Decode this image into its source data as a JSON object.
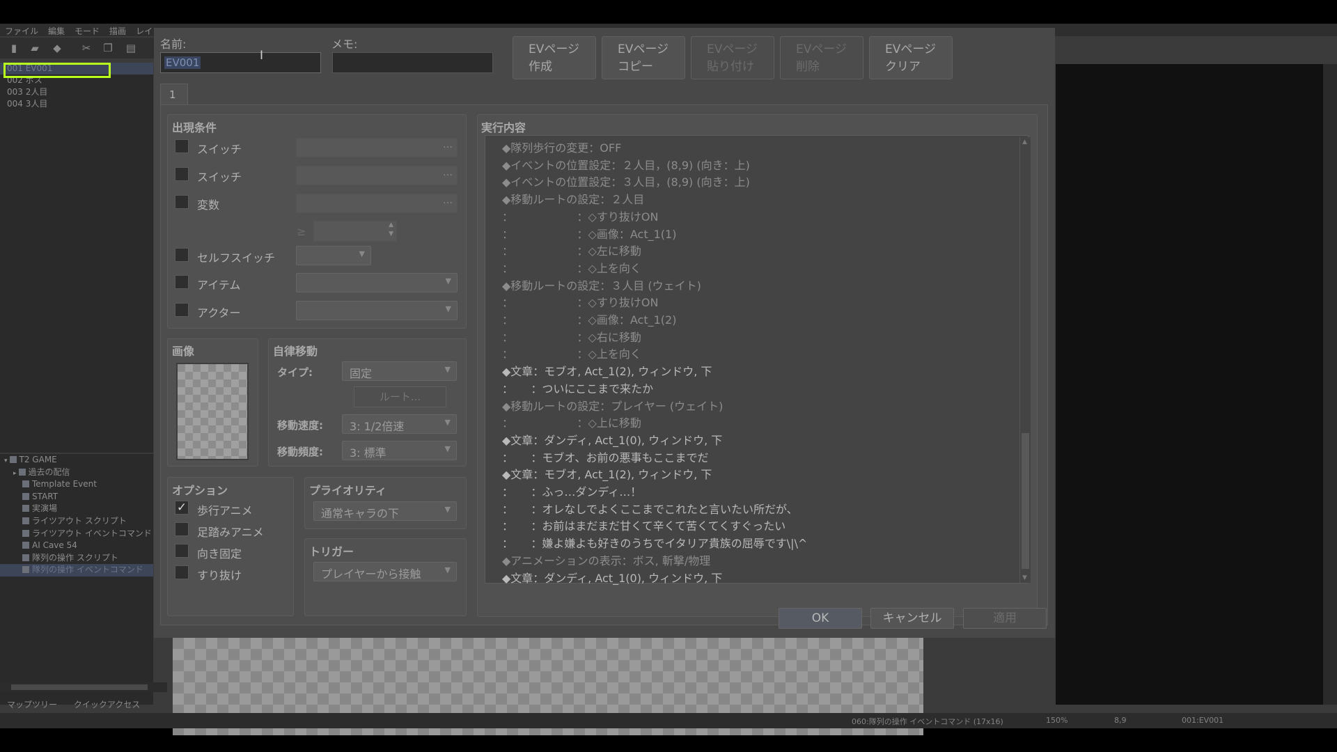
{
  "menubar": [
    "ファイル",
    "編集",
    "モード",
    "描画",
    "レイ"
  ],
  "event_list": [
    {
      "label": "001 EV001",
      "selected": true
    },
    {
      "label": "002 ボス",
      "selected": false
    },
    {
      "label": "003 2人目",
      "selected": false
    },
    {
      "label": "004 3人目",
      "selected": false
    }
  ],
  "map_tree": [
    {
      "label": "T2 GAME",
      "indent": 0,
      "expander": "▾",
      "selected": false
    },
    {
      "label": "過去の配信",
      "indent": 1,
      "expander": "▸",
      "selected": false
    },
    {
      "label": "Template Event",
      "indent": 2,
      "expander": "",
      "selected": false
    },
    {
      "label": "START",
      "indent": 2,
      "expander": "",
      "selected": false
    },
    {
      "label": "実演場",
      "indent": 2,
      "expander": "",
      "selected": false
    },
    {
      "label": "ライツアウト スクリプト",
      "indent": 2,
      "expander": "",
      "selected": false
    },
    {
      "label": "ライツアウト イベントコマンド",
      "indent": 2,
      "expander": "",
      "selected": false
    },
    {
      "label": "AI Cave 54",
      "indent": 2,
      "expander": "",
      "selected": false
    },
    {
      "label": "隊列の操作 スクリプト",
      "indent": 2,
      "expander": "",
      "selected": false
    },
    {
      "label": "隊列の操作 イベントコマンド",
      "indent": 2,
      "expander": "",
      "selected": true
    }
  ],
  "tree_tabs": [
    "マップツリー",
    "クイックアクセス"
  ],
  "status": {
    "map": "060:隊列の操作 イベントコマンド (17x16)",
    "zoom": "150%",
    "coords": "8,9",
    "event": "001:EV001"
  },
  "dialog": {
    "name_label": "名前:",
    "name_value": "EV001",
    "memo_label": "メモ:",
    "memo_value": "",
    "page_buttons": [
      {
        "label": "EVページ\n作成",
        "enabled": true
      },
      {
        "label": "EVページ\nコピー",
        "enabled": true
      },
      {
        "label": "EVページ\n貼り付け",
        "enabled": false
      },
      {
        "label": "EVページ\n削除",
        "enabled": false
      },
      {
        "label": "EVページ\nクリア",
        "enabled": true
      }
    ],
    "page_tab": "1",
    "conditions": {
      "title": "出現条件",
      "switch1": "スイッチ",
      "switch2": "スイッチ",
      "variable": "変数",
      "variable_value": "",
      "self_switch": "セルフスイッチ",
      "item": "アイテム",
      "actor": "アクター",
      "dots": "…",
      "ge": "≥"
    },
    "image": {
      "title": "画像"
    },
    "autonomous": {
      "title": "自律移動",
      "type_label": "タイプ:",
      "type_value": "固定",
      "route_button": "ルート...",
      "speed_label": "移動速度:",
      "speed_value": "3: 1/2倍速",
      "freq_label": "移動頻度:",
      "freq_value": "3: 標準"
    },
    "options": {
      "title": "オプション",
      "items": [
        {
          "label": "歩行アニメ",
          "checked": true
        },
        {
          "label": "足踏みアニメ",
          "checked": false
        },
        {
          "label": "向き固定",
          "checked": false
        },
        {
          "label": "すり抜け",
          "checked": false
        }
      ]
    },
    "priority": {
      "title": "プライオリティ",
      "value": "通常キャラの下"
    },
    "trigger": {
      "title": "トリガー",
      "value": "プレイヤーから接触"
    },
    "contents": {
      "title": "実行内容",
      "lines": [
        {
          "text": "◆隊列歩行の変更：OFF",
          "dim": true
        },
        {
          "text": "◆イベントの位置設定：２人目，(8,9) (向き：上)",
          "dim": true
        },
        {
          "text": "◆イベントの位置設定：３人目，(8,9) (向き：上)",
          "dim": true
        },
        {
          "text": "◆移動ルートの設定：２人目",
          "dim": true
        },
        {
          "text": "：                  ：◇すり抜けON",
          "dim": true
        },
        {
          "text": "：                  ：◇画像：Act_1(1)",
          "dim": true
        },
        {
          "text": "：                  ：◇左に移動",
          "dim": true
        },
        {
          "text": "：                  ：◇上を向く",
          "dim": true
        },
        {
          "text": "◆移動ルートの設定：３人目 (ウェイト)",
          "dim": true
        },
        {
          "text": "：                  ：◇すり抜けON",
          "dim": true
        },
        {
          "text": "：                  ：◇画像：Act_1(2)",
          "dim": true
        },
        {
          "text": "：                  ：◇右に移動",
          "dim": true
        },
        {
          "text": "：                  ：◇上を向く",
          "dim": true
        },
        {
          "text": "◆文章：モブオ, Act_1(2), ウィンドウ, 下",
          "dim": false
        },
        {
          "text": "：     ：ついにここまで来たか",
          "dim": false
        },
        {
          "text": "◆移動ルートの設定：プレイヤー (ウェイト)",
          "dim": true
        },
        {
          "text": "：                  ：◇上に移動",
          "dim": true
        },
        {
          "text": "◆文章：ダンディ, Act_1(0), ウィンドウ, 下",
          "dim": false
        },
        {
          "text": "：     ：モブオ、お前の悪事もここまでだ",
          "dim": false
        },
        {
          "text": "◆文章：モブオ, Act_1(2), ウィンドウ, 下",
          "dim": false
        },
        {
          "text": "：     ：ふっ…ダンディ…！",
          "dim": false
        },
        {
          "text": "：     ：オレなしでよくここまでこれたと言いたい所だが、",
          "dim": false
        },
        {
          "text": "：     ：お前はまだまだ甘くて辛くて苦くてくすぐったい",
          "dim": false
        },
        {
          "text": "：     ：嫌よ嫌よも好きのうちでイタリア貴族の屈辱です\\|\\^",
          "dim": false
        },
        {
          "text": "◆アニメーションの表示：ボス, 斬撃/物理",
          "dim": true
        },
        {
          "text": "◆文章：ダンディ, Act_1(0), ウィンドウ, 下",
          "dim": false
        }
      ]
    },
    "buttons": {
      "ok": "OK",
      "cancel": "キャンセル",
      "apply": "適用"
    }
  }
}
